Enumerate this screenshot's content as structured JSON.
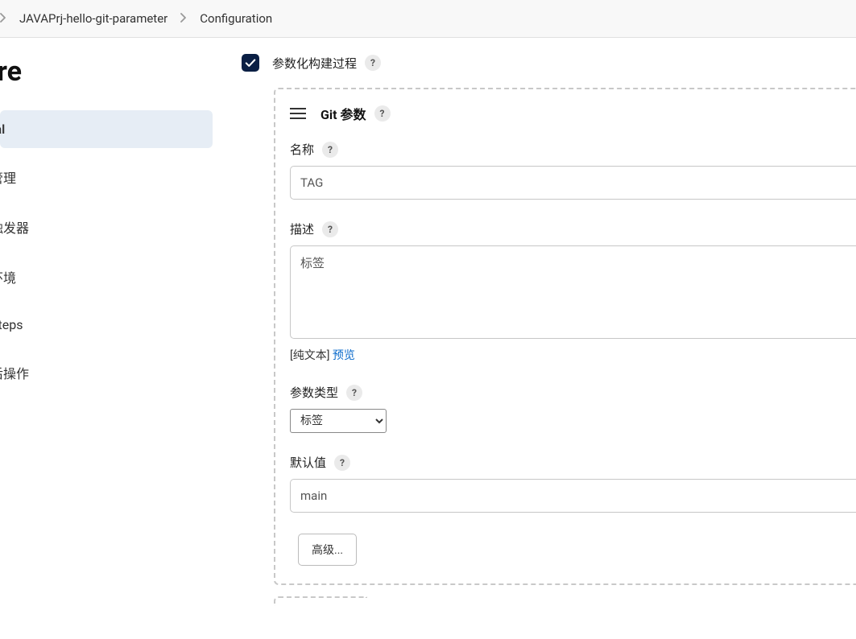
{
  "breadcrumb": {
    "project": "JAVAPrj-hello-git-parameter",
    "page": "Configuration"
  },
  "sidebar": {
    "title": "gure",
    "items": [
      {
        "label": "ral",
        "active": true
      },
      {
        "label": "管理",
        "active": false
      },
      {
        "label": "触发器",
        "active": false
      },
      {
        "label": "环境",
        "active": false
      },
      {
        "label": "Steps",
        "active": false
      },
      {
        "label": "后操作",
        "active": false
      }
    ]
  },
  "parametrized": {
    "label": "参数化构建过程"
  },
  "git_param": {
    "title": "Git 参数",
    "name_label": "名称",
    "name_value": "TAG",
    "desc_label": "描述",
    "desc_value": "标签",
    "plain_text": "[纯文本]",
    "preview": "预览",
    "type_label": "参数类型",
    "type_value": "标签",
    "default_label": "默认值",
    "default_value": "main",
    "advanced": "高级..."
  }
}
